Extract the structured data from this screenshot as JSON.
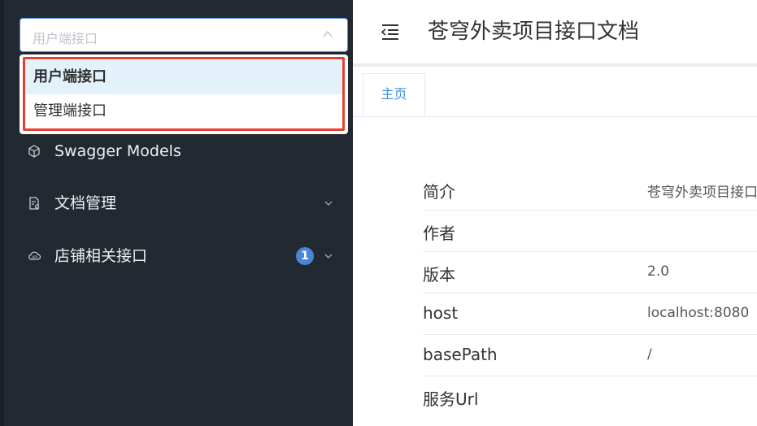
{
  "sidebar": {
    "group_select": {
      "placeholder": "用户端接口",
      "options": [
        {
          "label": "用户端接口",
          "selected": true
        },
        {
          "label": "管理端接口",
          "selected": false
        }
      ]
    },
    "items": [
      {
        "label": "Swagger Models",
        "icon": "cube-icon"
      },
      {
        "label": "文档管理",
        "icon": "document-gear-icon"
      },
      {
        "label": "店铺相关接口",
        "icon": "cloud-api-icon",
        "badge": "1"
      }
    ]
  },
  "header": {
    "title": "苍穹外卖项目接口文档"
  },
  "tabs": [
    {
      "label": "主页",
      "active": true
    }
  ],
  "info": {
    "rows": [
      {
        "key": "简介",
        "value": "苍穹外卖项目接口"
      },
      {
        "key": "作者",
        "value": ""
      },
      {
        "key": "版本",
        "value": "2.0"
      },
      {
        "key": "host",
        "value": "localhost:8080"
      },
      {
        "key": "basePath",
        "value": "/"
      },
      {
        "key": "服务Url",
        "value": ""
      }
    ]
  },
  "colors": {
    "sidebar_bg": "#222930",
    "accent": "#3a8ee6",
    "highlight_border": "#e0412e",
    "badge": "#4b86d6"
  }
}
